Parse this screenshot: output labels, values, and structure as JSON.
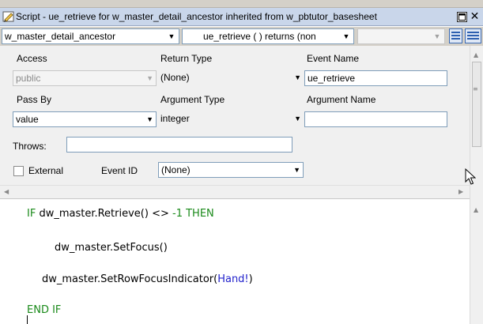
{
  "window": {
    "title": "Script - ue_retrieve for w_master_detail_ancestor inherited from w_pbtutor_basesheet"
  },
  "selectors": {
    "object": "w_master_detail_ancestor",
    "event": "ue_retrieve ( ) returns (non",
    "third": ""
  },
  "labels": {
    "access": "Access",
    "return_type": "Return Type",
    "event_name": "Event Name",
    "pass_by": "Pass By",
    "argument_type": "Argument Type",
    "argument_name": "Argument Name",
    "throws": "Throws:",
    "external": "External",
    "event_id": "Event ID"
  },
  "fields": {
    "access": "public",
    "return_type": "(None)",
    "event_name": "ue_retrieve",
    "pass_by": "value",
    "argument_type": "integer",
    "argument_name": "",
    "throws": "",
    "event_id": "(None)",
    "external_checked": false
  },
  "code": {
    "line1": {
      "kw1": "IF",
      "mid": " dw_master.Retrieve() <> ",
      "num": "-1",
      "kw2": " THEN"
    },
    "line2": "dw_master.SetFocus()",
    "line3": {
      "pre": "dw_master.SetRowFocusIndicator(",
      "enum": "Hand!",
      "post": ")"
    },
    "line4": "END IF"
  },
  "colors": {
    "keyword": "#1a8a1a",
    "enum": "#2222cc",
    "titlebar": "#c9d6ea"
  },
  "icons": [
    "script-icon",
    "maximize-icon",
    "close-icon",
    "chevron-down-icon",
    "view-layout-icon",
    "mouse-pointer-icon"
  ]
}
